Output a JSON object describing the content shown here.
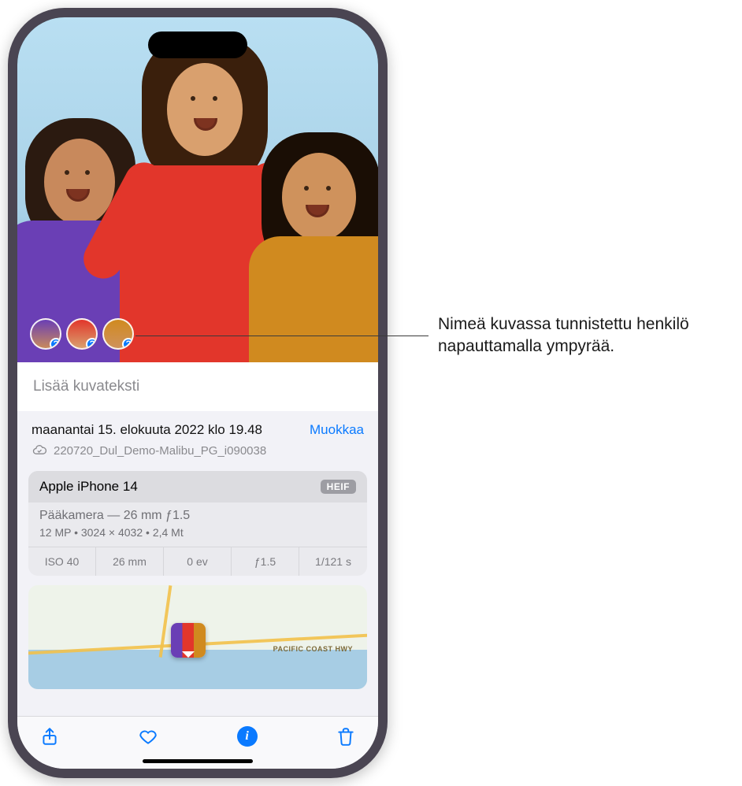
{
  "caption": {
    "placeholder": "Lisää kuvateksti"
  },
  "datetime": "maanantai 15. elokuuta 2022 klo 19.48",
  "edit_label": "Muokkaa",
  "filename": "220720_Dul_Demo-Malibu_PG_i090038",
  "device": "Apple iPhone 14",
  "format_badge": "HEIF",
  "lens_line": "Pääkamera — 26 mm ƒ1.5",
  "resolution_line": "12 MP  •  3024 × 4032  •  2,4 Mt",
  "exif": {
    "iso": "ISO 40",
    "focal": "26 mm",
    "ev": "0 ev",
    "aperture": "ƒ1.5",
    "shutter": "1/121 s"
  },
  "map": {
    "road_label": "PACIFIC COAST HWY"
  },
  "people_badge": "?",
  "callout": "Nimeä kuvassa tunnistettu henkilö napauttamalla ympyrää."
}
